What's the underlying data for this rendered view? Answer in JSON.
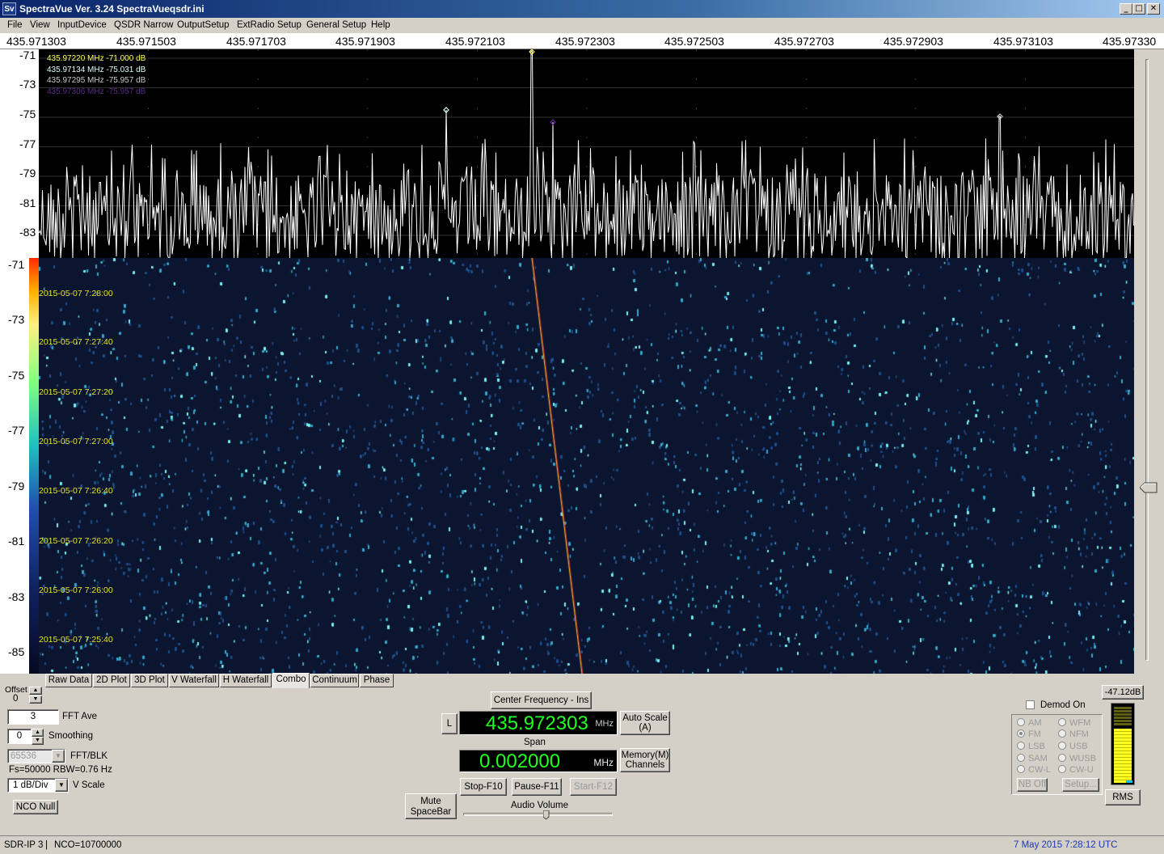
{
  "window": {
    "title": "SpectraVue Ver. 3.24  SpectraVueqsdr.ini",
    "logo_text": "Sv",
    "minimize": "_",
    "maximize": "□",
    "close": "✕"
  },
  "menu": [
    "File",
    "View",
    "InputDevice",
    "QSDR Narrow",
    "OutputSetup",
    "ExtRadio Setup",
    "General Setup",
    "Help"
  ],
  "freq_ticks": [
    "435.971303",
    "435.971503",
    "435.971703",
    "435.971903",
    "435.972103",
    "435.972303",
    "435.972503",
    "435.972703",
    "435.972903",
    "435.973103",
    "435.97330"
  ],
  "spectrum_db_ticks": [
    "-71",
    "-73",
    "-75",
    "-77",
    "-79",
    "-81",
    "-83"
  ],
  "waterfall_db_ticks": [
    "-71",
    "-73",
    "-75",
    "-77",
    "-79",
    "-81",
    "-83",
    "-85"
  ],
  "markers": [
    {
      "text": "435.97220 MHz  -71.000 dB",
      "color": "#ffff60"
    },
    {
      "text": "435.97134 MHz  -75.031 dB",
      "color": "#e0ffff"
    },
    {
      "text": "435.97295 MHz  -75.957 dB",
      "color": "#cccccc"
    },
    {
      "text": "435.97306 MHz  -75.957 dB",
      "color": "#5a2a8a"
    }
  ],
  "timestamps": [
    "2015-05-07 7:28:00",
    "2015-05-07 7:27:40",
    "2015-05-07 7:27:20",
    "2015-05-07 7:27:00",
    "2015-05-07 7:26:40",
    "2015-05-07 7:26:20",
    "2015-05-07 7:26:00",
    "2015-05-07 7:25:40"
  ],
  "tabs": [
    "Raw Data",
    "2D Plot",
    "3D Plot",
    "V Waterfall",
    "H Waterfall",
    "Combo",
    "Continuum",
    "Phase"
  ],
  "active_tab": "Combo",
  "controls": {
    "offset_label": "Offset",
    "offset_value": "0",
    "fft_ave_value": "3",
    "fft_ave_label": "FFT Ave",
    "smoothing_value": "0",
    "smoothing_label": "Smoothing",
    "fft_blk_value": "65536",
    "fft_blk_label": "FFT/BLK",
    "fs_text": "Fs=50000 RBW=0.76 Hz",
    "vscale_value": "1 dB/Div",
    "vscale_label": "V Scale",
    "nco_null": "NCO Null"
  },
  "center": {
    "center_freq_button": "Center Frequency - Ins",
    "l_button": "L",
    "freq_display": "435.972303",
    "freq_unit": "MHz",
    "auto_scale": "Auto Scale",
    "auto_scale_key": "(A)",
    "span_label": "Span",
    "span_display": "0.002000",
    "span_unit": "MHz",
    "memory": "Memory(M)",
    "channels": "Channels",
    "stop": "Stop-F10",
    "pause": "Pause-F11",
    "start": "Start-F12",
    "mute": "Mute",
    "mute_key": "SpaceBar",
    "audio_volume": "Audio Volume",
    "audio_volume_level": 0.5
  },
  "demod": {
    "demod_on": "Demod On",
    "modes_left": [
      "AM",
      "FM",
      "LSB",
      "SAM",
      "CW-L"
    ],
    "modes_right": [
      "WFM",
      "NFM",
      "USB",
      "WUSB",
      "CW-U"
    ],
    "selected": "FM",
    "nb_off": "NB Off",
    "setup": "Setup..."
  },
  "meter": {
    "level_text": "-47.12dB",
    "rms": "RMS",
    "fill_fraction": 0.7
  },
  "status": {
    "device": "SDR-IP 3",
    "separator": "|",
    "nco": "NCO=10700000",
    "datetime": "7 May 2015  7:28:12 UTC"
  },
  "colors": {
    "lcd_green": "#20ff20",
    "spectrum_trace": "#ffffff",
    "timestamp": "#e8e030",
    "status_date": "#1a3ab0"
  }
}
